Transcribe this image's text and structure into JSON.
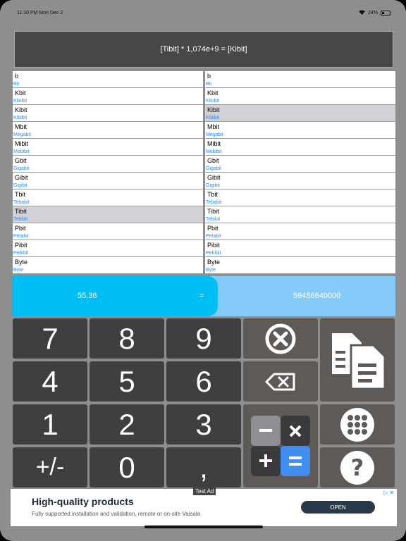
{
  "status_bar": {
    "time": "11:10 PM   Mon Dec 2",
    "battery": "24%"
  },
  "formula": "[Tibit] * 1,074e+9 = [Kibit]",
  "units": [
    {
      "abbr": "b",
      "full": "Bit"
    },
    {
      "abbr": "Kbit",
      "full": "Kilobit"
    },
    {
      "abbr": "Kibit",
      "full": "Kibibit"
    },
    {
      "abbr": "Mbit",
      "full": "Megabit"
    },
    {
      "abbr": "Mibit",
      "full": "Mebibit"
    },
    {
      "abbr": "Gbit",
      "full": "Gigabit"
    },
    {
      "abbr": "Gibit",
      "full": "Gigibit"
    },
    {
      "abbr": "Tbit",
      "full": "Tebabit"
    },
    {
      "abbr": "Tibit",
      "full": "Tebibit"
    },
    {
      "abbr": "Pbit",
      "full": "Petabit"
    },
    {
      "abbr": "Pibit",
      "full": "Pebibit"
    },
    {
      "abbr": "Byte",
      "full": "Byte"
    }
  ],
  "selected_from": "Tibit",
  "selected_to": "Kibit",
  "result": {
    "input": "55.36",
    "equals": "=",
    "output": "59456640000"
  },
  "keypad": {
    "k7": "7",
    "k8": "8",
    "k9": "9",
    "k4": "4",
    "k5": "5",
    "k6": "6",
    "k1": "1",
    "k2": "2",
    "k3": "3",
    "sign": "+/-",
    "k0": "0",
    "comma": ","
  },
  "icons": {
    "clear": "clear-x-icon",
    "backspace": "backspace-icon",
    "copy": "copy-icon",
    "calculator": "calculator-icon",
    "menu": "grid-menu-icon",
    "help": "help-icon"
  },
  "colors": {
    "accent": "#00bff7",
    "output_bg": "#84cbfa",
    "key": "#3f3f3f",
    "func_key": "#5d5a58",
    "link_blue": "#2a8cf5",
    "calc_blue": "#3f8ef0"
  },
  "ad": {
    "tag": "Test Ad",
    "title": "High-quality products",
    "subtitle": "Fully supported installation and validation, remote or on-site Vaisala",
    "button": "OPEN",
    "close": "▷ ✕"
  }
}
